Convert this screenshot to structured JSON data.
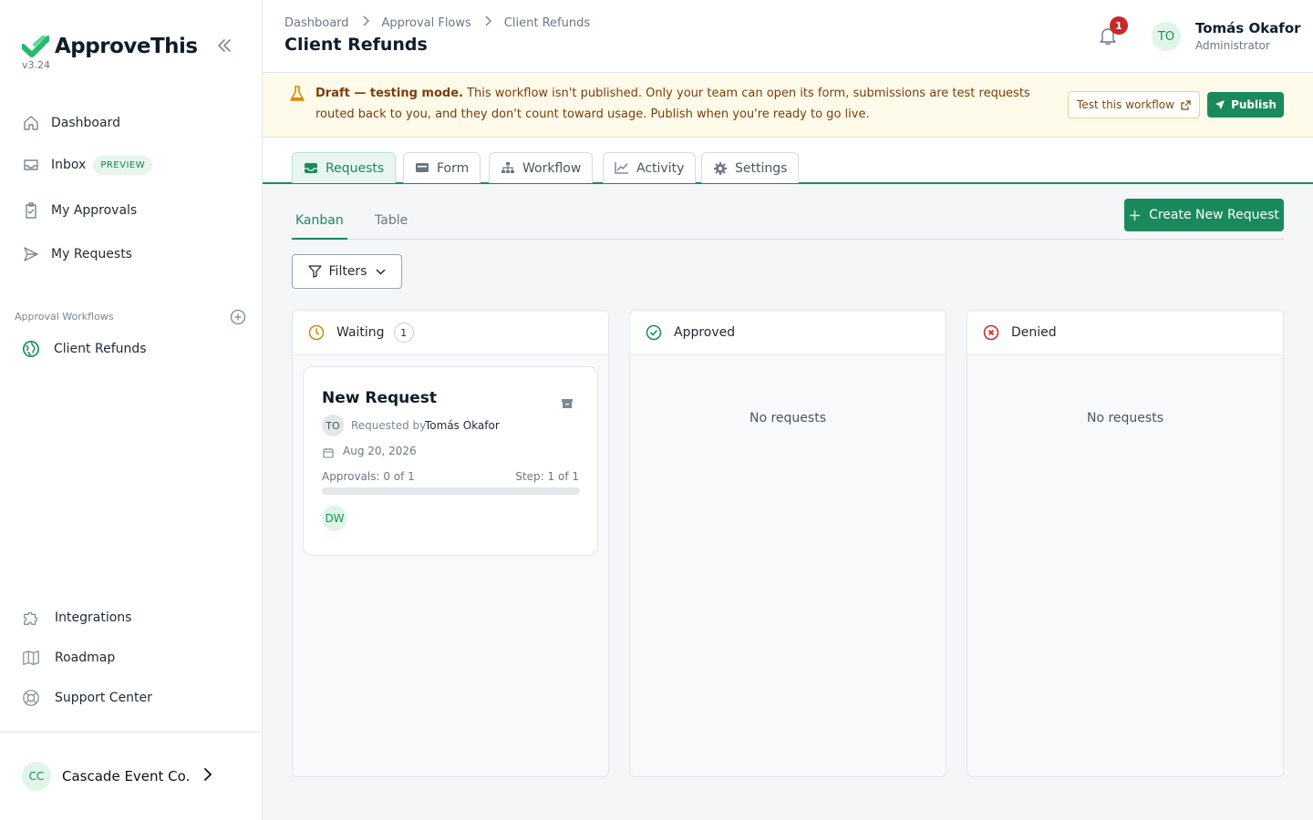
{
  "app": {
    "name": "ApproveThis",
    "version": "v3.24",
    "brand_color": "#1a8a5c"
  },
  "sidebar": {
    "nav": [
      {
        "label": "Dashboard",
        "icon": "home-icon"
      },
      {
        "label": "Inbox",
        "icon": "inbox-icon",
        "badge": "PREVIEW"
      },
      {
        "label": "My Approvals",
        "icon": "clipboard-check-icon"
      },
      {
        "label": "My Requests",
        "icon": "send-icon"
      }
    ],
    "workflows_title": "Approval Workflows",
    "workflows": [
      {
        "label": "Client Refunds",
        "icon": "globe-icon"
      }
    ],
    "bottom": [
      {
        "label": "Integrations",
        "icon": "puzzle-icon"
      },
      {
        "label": "Roadmap",
        "icon": "map-icon"
      },
      {
        "label": "Support Center",
        "icon": "lifebuoy-icon"
      }
    ],
    "org": {
      "initials": "CC",
      "name": "Cascade Event Co."
    }
  },
  "header": {
    "breadcrumb": [
      "Dashboard",
      "Approval Flows",
      "Client Refunds"
    ],
    "title": "Client Refunds",
    "notifications": "1",
    "user": {
      "initials": "TO",
      "name": "Tomás Okafor",
      "role": "Administrator"
    }
  },
  "banner": {
    "strong": "Draft — testing mode.",
    "text": " This workflow isn't published. Only your team can open its form, submissions are test requests routed back to you, and they don't count toward usage. Publish when you're ready to go live.",
    "test_label": "Test this workflow",
    "publish_label": "Publish"
  },
  "tabs": [
    {
      "label": "Requests",
      "icon": "inbox-tray-icon",
      "active": true
    },
    {
      "label": "Form",
      "icon": "form-icon"
    },
    {
      "label": "Workflow",
      "icon": "sitemap-icon"
    },
    {
      "label": "Activity",
      "icon": "chart-line-icon"
    },
    {
      "label": "Settings",
      "icon": "gear-icon"
    }
  ],
  "views": {
    "kanban": "Kanban",
    "table": "Table",
    "active": "Kanban"
  },
  "create_label": "Create New Request",
  "filters_label": "Filters",
  "columns": [
    {
      "label": "Waiting",
      "count": "1",
      "color": "#c98a0a"
    },
    {
      "label": "Approved",
      "color": "#1a8a5c",
      "empty": "No requests"
    },
    {
      "label": "Denied",
      "color": "#c72929",
      "empty": "No requests"
    }
  ],
  "card": {
    "title": "New Request",
    "requester_initials": "TO",
    "requested_by": "Requested by",
    "requester_name": "Tomás Okafor",
    "date": "Aug 20, 2026",
    "approvals": "Approvals: 0 of 1",
    "step": "Step: 1 of 1",
    "progress": 0,
    "approver_initials": "DW"
  }
}
